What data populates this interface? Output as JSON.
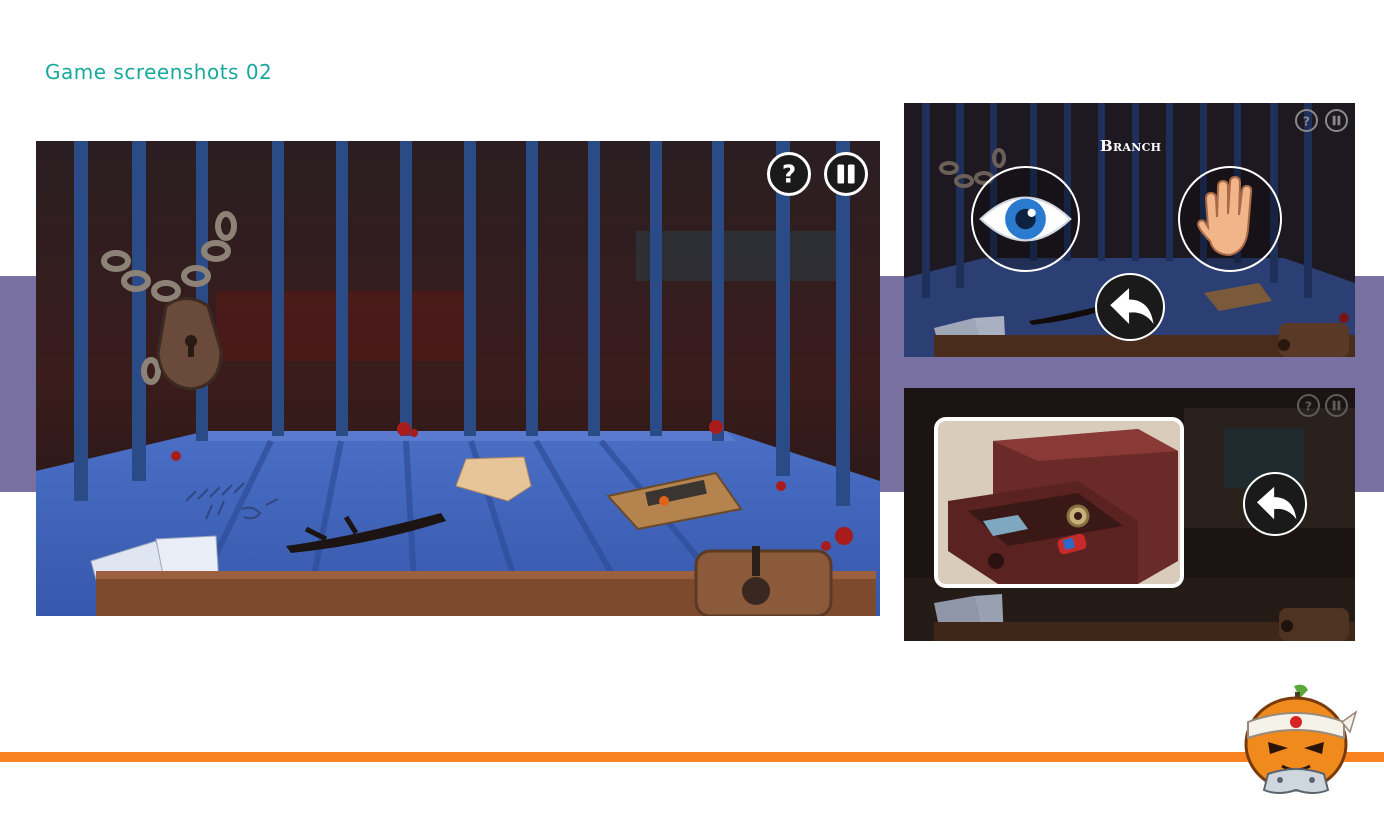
{
  "page": {
    "title": "Game screenshots 02",
    "colors": {
      "title": "#19a89c",
      "band": "#7870a0",
      "accent_line": "#f98222",
      "cage_bars": "#2b4b86",
      "cage_floor": "#3b5fb4",
      "dark_bg": "#1b1412"
    }
  },
  "screens": {
    "main": {
      "help_icon": "question-icon",
      "pause_icon": "pause-icon"
    },
    "interact": {
      "item_label": "Branch",
      "look_icon": "eye-icon",
      "use_icon": "hand-icon",
      "back_icon": "back-arrow-icon"
    },
    "closeup": {
      "view": "drawer-closeup",
      "back_icon": "back-arrow-icon"
    }
  }
}
